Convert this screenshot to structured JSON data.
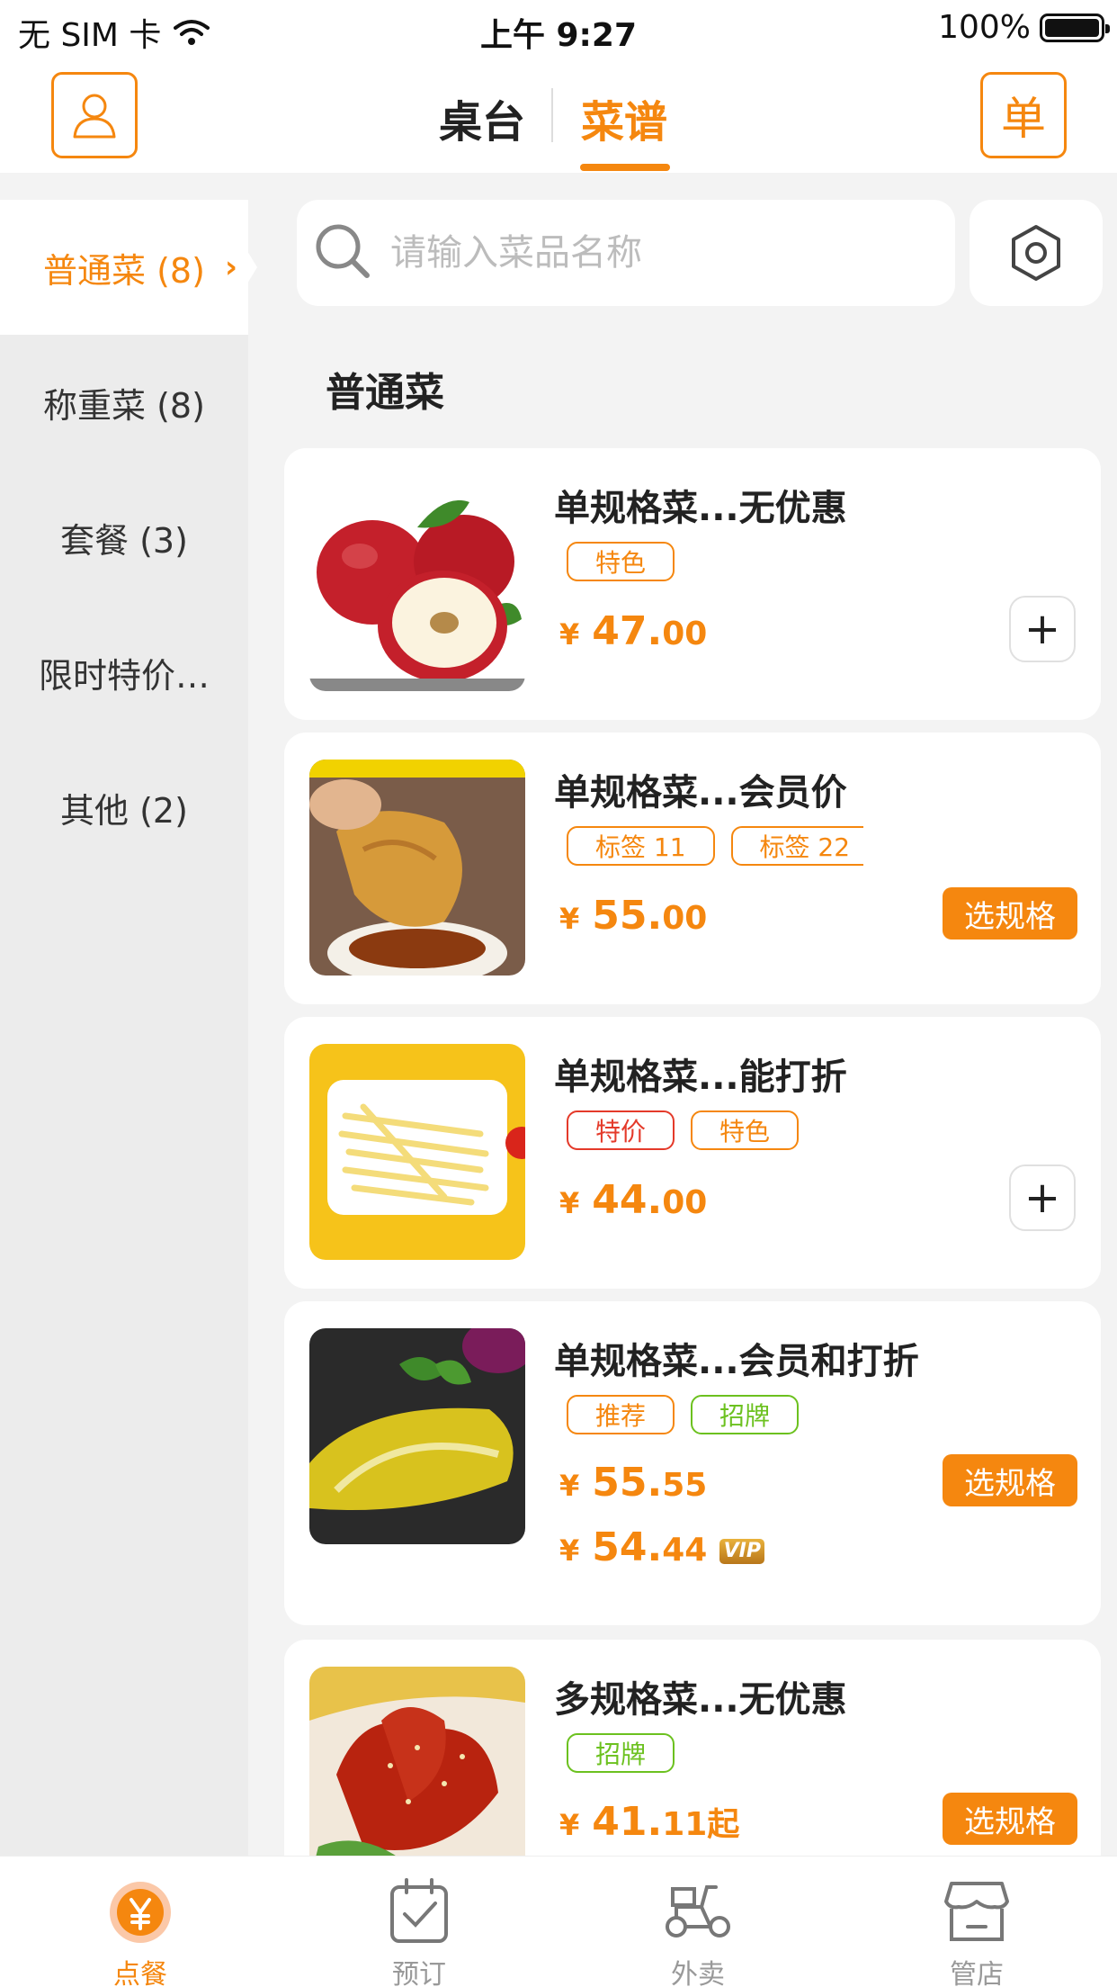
{
  "status_bar": {
    "carrier": "无 SIM 卡",
    "time": "上午 9:27",
    "battery": "100%"
  },
  "header": {
    "tabs": [
      {
        "label": "桌台"
      },
      {
        "label": "菜谱"
      }
    ],
    "active_tab": "菜谱",
    "order_button_label": "单",
    "accent_color": "#f5870f"
  },
  "sidebar": {
    "categories": [
      {
        "label": "普通菜 (8)"
      },
      {
        "label": "称重菜 (8)"
      },
      {
        "label": "套餐 (3)"
      },
      {
        "label": "限时特价…"
      },
      {
        "label": "其他 (2)"
      }
    ],
    "active_index": 0
  },
  "search": {
    "placeholder": "请输入菜品名称"
  },
  "section_title": "普通菜",
  "dishes": [
    {
      "name": "单规格菜...无优惠",
      "tags": [
        "特色"
      ],
      "price_symbol": "¥",
      "price_int": "47.",
      "price_dec": "00",
      "action": "plus"
    },
    {
      "name": "单规格菜...会员价",
      "tags": [
        "标签 11",
        "标签 22"
      ],
      "price_symbol": "¥",
      "price_int": "55.",
      "price_dec": "00",
      "action": "选规格"
    },
    {
      "name": "单规格菜...能打折",
      "tags": [
        "特价",
        "特色"
      ],
      "price_symbol": "¥",
      "price_int": "44.",
      "price_dec": "00",
      "action": "plus"
    },
    {
      "name": "单规格菜...会员和打折",
      "tags": [
        "推荐",
        "招牌"
      ],
      "price_symbol": "¥",
      "price_int": "55.",
      "price_dec": "55",
      "member_price_int": "54.",
      "member_price_dec": "44",
      "vip_label": "VIP",
      "action": "选规格"
    },
    {
      "name": "多规格菜...无优惠",
      "tags": [
        "招牌"
      ],
      "price_symbol": "¥",
      "price_int": "41.",
      "price_dec": "11",
      "price_suffix": "起",
      "action": "选规格"
    }
  ],
  "tabbar": {
    "items": [
      {
        "label": "点餐",
        "icon": "yen-icon"
      },
      {
        "label": "预订",
        "icon": "calendar-check-icon"
      },
      {
        "label": "外卖",
        "icon": "scooter-icon"
      },
      {
        "label": "管店",
        "icon": "store-icon"
      }
    ],
    "active_index": 0
  }
}
